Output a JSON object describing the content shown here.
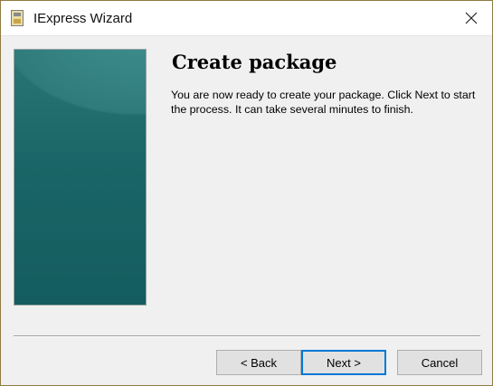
{
  "window": {
    "title": "IExpress Wizard",
    "icon": "iexpress-app-icon",
    "close_icon": "close-icon"
  },
  "content": {
    "heading": "Create package",
    "description": "You are now ready to create your package.  Click Next to start the process.  It can take several minutes to finish."
  },
  "buttons": {
    "back_label": "< Back",
    "next_label": "Next >",
    "cancel_label": "Cancel"
  },
  "colors": {
    "panel_teal": "#1a6567",
    "focus_blue": "#0078d7",
    "frame_border": "#8e7a43"
  }
}
